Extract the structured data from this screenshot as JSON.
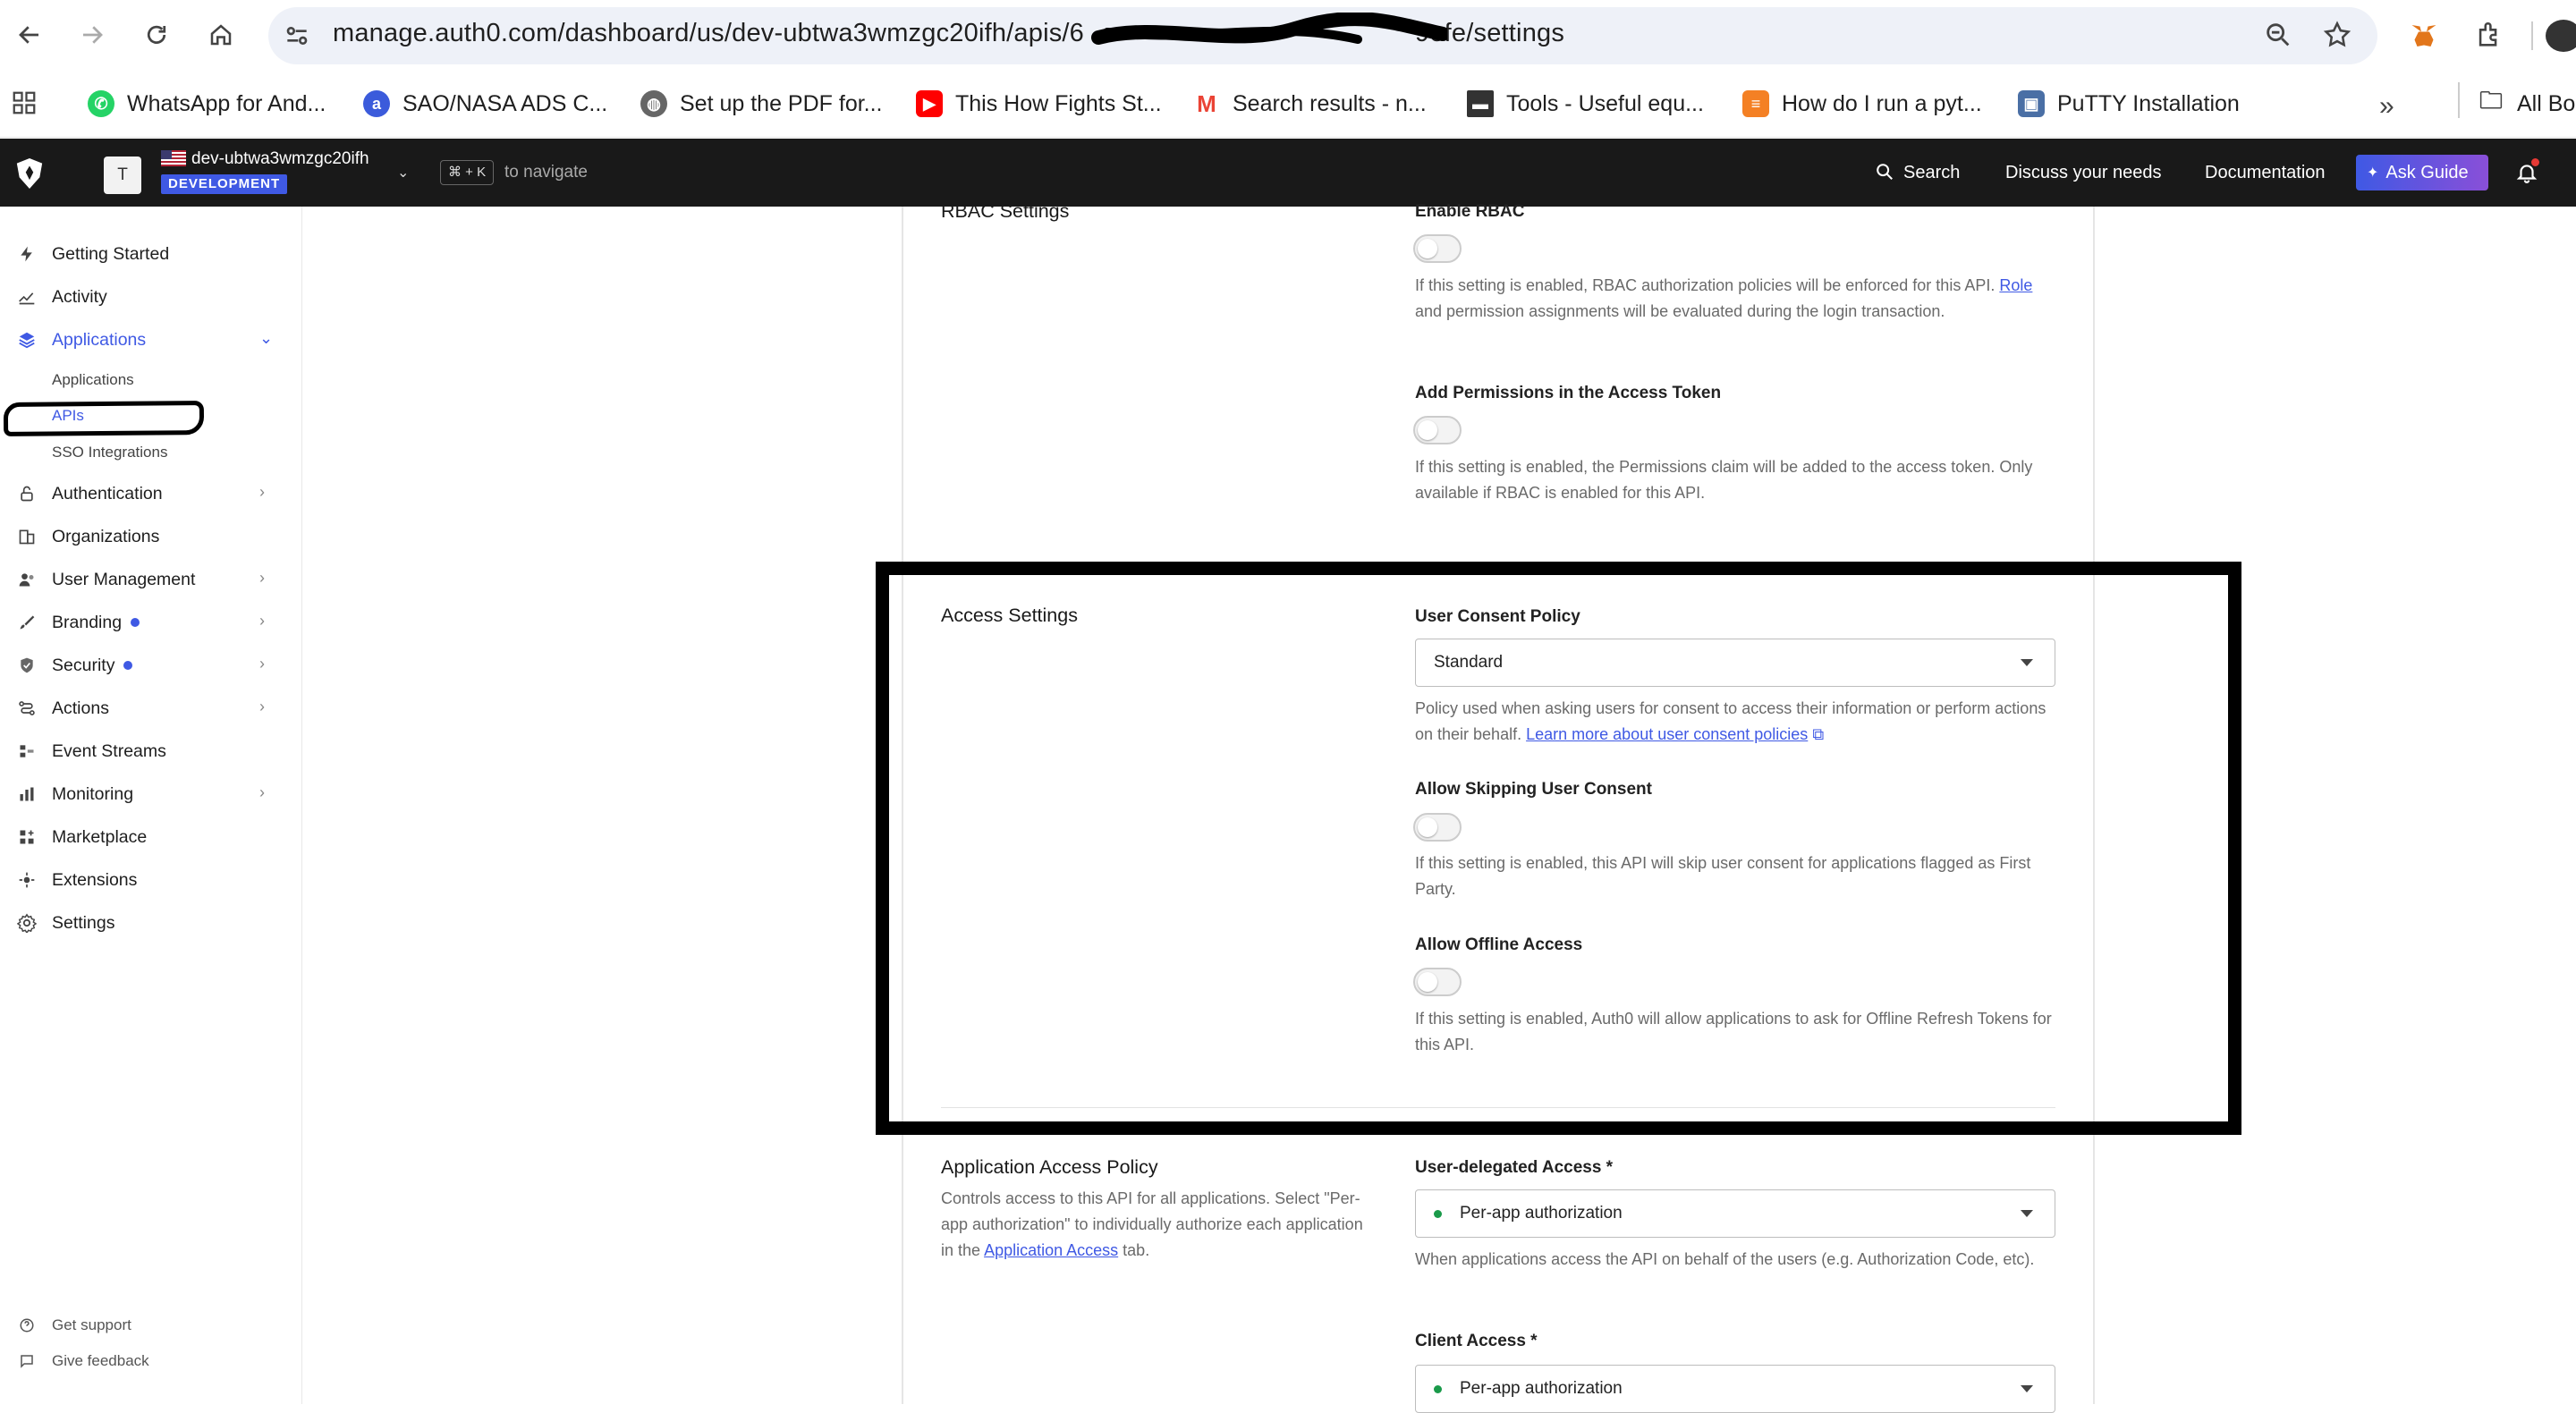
{
  "browser": {
    "url": "manage.auth0.com/dashboard/us/dev-ubtwa3wmzgc20ifh/apis/6",
    "url_tail": "9efe/settings",
    "bookmarks": [
      {
        "label": "WhatsApp for And...",
        "icon": "whatsapp-icon",
        "color": "#25d366"
      },
      {
        "label": "SAO/NASA ADS C...",
        "icon": "ads-icon",
        "color": "#3b5bdb"
      },
      {
        "label": "Set up the PDF for...",
        "icon": "globe-icon",
        "color": "#555555"
      },
      {
        "label": "This How Fights St...",
        "icon": "youtube-icon",
        "color": "#ff0000"
      },
      {
        "label": "Search results - n...",
        "icon": "gmail-icon",
        "color": "#ea4335"
      },
      {
        "label": "Tools - Useful equ...",
        "icon": "tools-icon",
        "color": "#333333"
      },
      {
        "label": "How do I run a pyt...",
        "icon": "stackoverflow-icon",
        "color": "#f48024"
      },
      {
        "label": "PuTTY Installation",
        "icon": "putty-icon",
        "color": "#4a6fa5"
      }
    ],
    "all_bookmarks": "All Bo"
  },
  "topbar": {
    "tenant_initial": "T",
    "tenant_name": "dev-ubtwa3wmzgc20ifh",
    "env_badge": "DEVELOPMENT",
    "shortcut": "⌘ + K",
    "shortcut_hint": "to navigate",
    "search": "Search",
    "discuss": "Discuss your needs",
    "docs": "Documentation",
    "ask_guide": "Ask Guide"
  },
  "sidebar": {
    "items": [
      {
        "label": "Getting Started",
        "icon": "bolt-icon"
      },
      {
        "label": "Activity",
        "icon": "activity-icon"
      },
      {
        "label": "Applications",
        "icon": "layers-icon"
      },
      {
        "label": "Authentication",
        "icon": "lock-icon"
      },
      {
        "label": "Organizations",
        "icon": "building-icon"
      },
      {
        "label": "User Management",
        "icon": "users-icon"
      },
      {
        "label": "Branding",
        "icon": "brush-icon"
      },
      {
        "label": "Security",
        "icon": "shield-icon"
      },
      {
        "label": "Actions",
        "icon": "flow-icon"
      },
      {
        "label": "Event Streams",
        "icon": "stream-icon"
      },
      {
        "label": "Monitoring",
        "icon": "bar-chart-icon"
      },
      {
        "label": "Marketplace",
        "icon": "grid-plus-icon"
      },
      {
        "label": "Extensions",
        "icon": "puzzle-icon"
      },
      {
        "label": "Settings",
        "icon": "gear-icon"
      }
    ],
    "sub_items": [
      "Applications",
      "APIs",
      "SSO Integrations"
    ],
    "footer": [
      "Get support",
      "Give feedback"
    ]
  },
  "rbac": {
    "title": "RBAC Settings",
    "enable_label": "Enable RBAC",
    "enable_help_1": "If this setting is enabled, RBAC authorization policies will be enforced for this API.",
    "enable_help_link": "Role",
    "enable_help_2": "and permission assignments will be evaluated during the login transaction.",
    "perm_label": "Add Permissions in the Access Token",
    "perm_help": "If this setting is enabled, the Permissions claim will be added to the access token. Only available if RBAC is enabled for this API."
  },
  "access": {
    "title": "Access Settings",
    "consent_label": "User Consent Policy",
    "consent_value": "Standard",
    "consent_help": "Policy used when asking users for consent to access their information or perform actions on their behalf.",
    "consent_link": "Learn more about user consent policies",
    "skip_label": "Allow Skipping User Consent",
    "skip_help": "If this setting is enabled, this API will skip user consent for applications flagged as First Party.",
    "offline_label": "Allow Offline Access",
    "offline_help": "If this setting is enabled, Auth0 will allow applications to ask for Offline Refresh Tokens for this API."
  },
  "app_access": {
    "title": "Application Access Policy",
    "desc_1": "Controls access to this API for all applications. Select \"Per-app authorization\" to individually authorize each application in the",
    "desc_link": "Application Access",
    "desc_2": "tab.",
    "delegated_label": "User-delegated Access *",
    "delegated_value": "Per-app authorization",
    "delegated_help": "When applications access the API on behalf of the users (e.g. Authorization Code, etc).",
    "client_label": "Client Access *",
    "client_value": "Per-app authorization"
  }
}
